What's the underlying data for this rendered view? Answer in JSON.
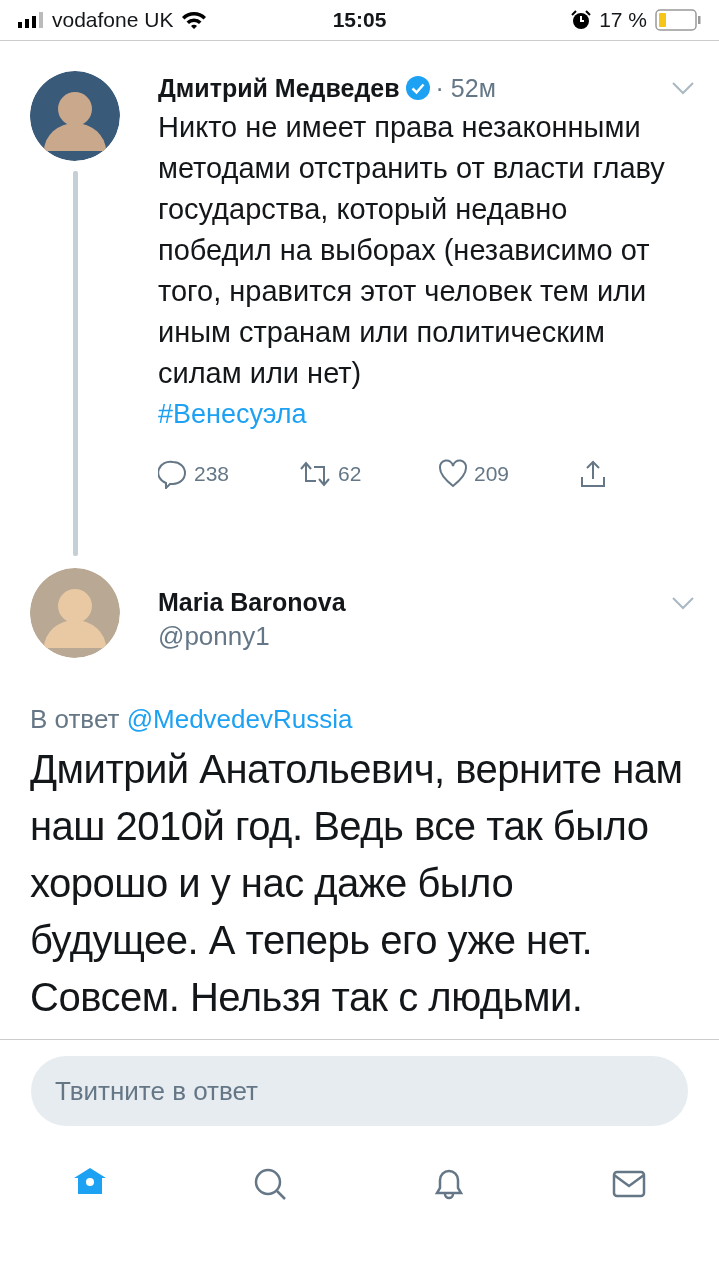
{
  "status_bar": {
    "carrier": "vodafone UK",
    "time": "15:05",
    "battery": "17 %"
  },
  "tweets": [
    {
      "name": "Дмитрий Медведев",
      "verified": true,
      "time": "· 52м",
      "text": "Никто не имеет права незаконными методами отстранить от власти главу государства, который недавно победил на выборах (независимо от того, нравится этот человек тем или иным странам или политическим силам или нет)",
      "hashtag": "#Венесуэла",
      "replies": "238",
      "retweets": "62",
      "likes": "209"
    }
  ],
  "reply": {
    "name": "Maria Baronova",
    "handle": "@ponny1",
    "reply_prefix": "В ответ",
    "reply_to": "@MedvedevRussia",
    "text": "Дмитрий Анатольевич, верните нам наш 2010й год. Ведь все так было хорошо и у нас даже было будущее. А теперь его уже нет. Совсем. Нельзя так с людьми."
  },
  "compose": {
    "placeholder": "Твитните в ответ"
  },
  "tabs": [
    {
      "kind": "home",
      "selected": true
    },
    {
      "kind": "search",
      "selected": false
    },
    {
      "kind": "notifications",
      "selected": false
    },
    {
      "kind": "messages",
      "selected": false
    }
  ]
}
